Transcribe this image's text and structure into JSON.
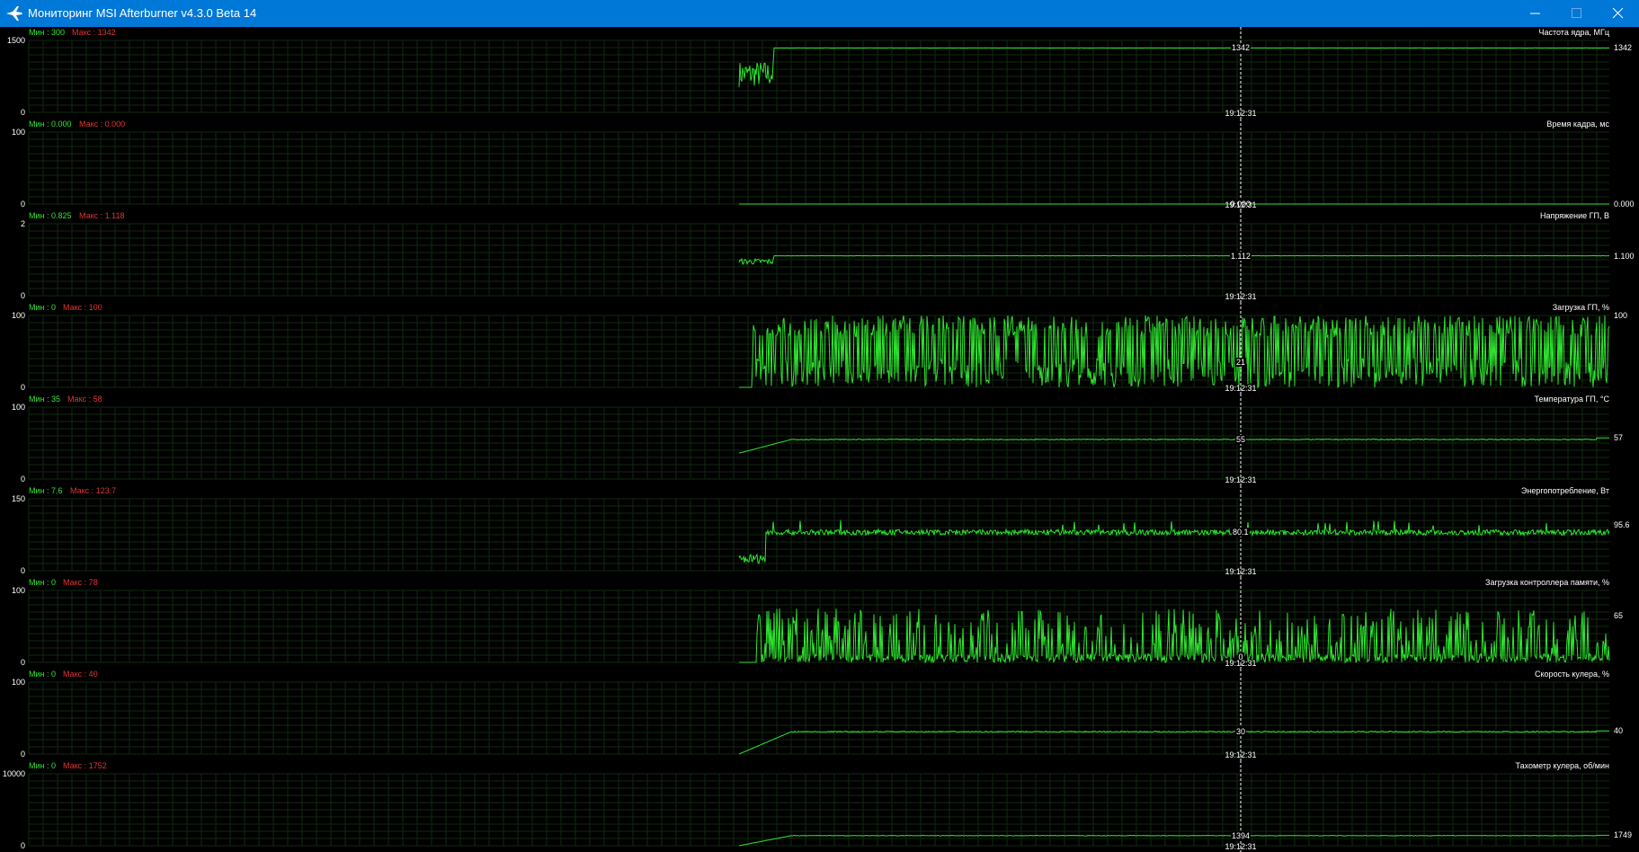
{
  "window": {
    "title": "Мониторинг MSI Afterburner v4.3.0 Beta 14",
    "app_icon": "afterburner-plane-icon",
    "controls": [
      "minimize-icon",
      "maximize-icon",
      "close-icon"
    ]
  },
  "colors": {
    "titlebar": "#0078d7",
    "graph": "#2ee62e",
    "grid": "#0f2a0f",
    "min_label": "#34e834",
    "max_label": "#e23535",
    "cursor": "#ffffff"
  },
  "cursor_time": "19:12:31",
  "graphs": [
    {
      "name": "Частота ядра, МГц",
      "min_label": "Мин : 300",
      "max_label": "Макс : 1342",
      "y_top": "1500",
      "y_bottom": "0",
      "ymax": 1500,
      "cursor_value": "1342",
      "current_value": "1342",
      "pattern": "step",
      "base": 1342,
      "start": 800,
      "noise": 4
    },
    {
      "name": "Время кадра, мс",
      "min_label": "Мин : 0.000",
      "max_label": "Макс : 0.000",
      "y_top": "100",
      "y_bottom": "0",
      "ymax": 100,
      "cursor_value": "0.000",
      "current_value": "0.000",
      "pattern": "flat",
      "base": 0,
      "start": 0,
      "noise": 0
    },
    {
      "name": "Напряжение ГП, В",
      "min_label": "Мин : 0.825",
      "max_label": "Макс : 1.118",
      "y_top": "2",
      "y_bottom": "0",
      "ymax": 2,
      "cursor_value": "1.112",
      "current_value": "1.100",
      "pattern": "step",
      "base": 1.11,
      "start": 0.95,
      "noise": 0.005
    },
    {
      "name": "Загрузка ГП, %",
      "min_label": "Мин : 0",
      "max_label": "Макс : 100",
      "y_top": "100",
      "y_bottom": "0",
      "ymax": 100,
      "cursor_value": "21",
      "current_value": "100",
      "pattern": "spiky",
      "base": 55,
      "start": 0,
      "noise": 45
    },
    {
      "name": "Температура ГП, °С",
      "min_label": "Мин : 35",
      "max_label": "Макс : 58",
      "y_top": "100",
      "y_bottom": "0",
      "ymax": 100,
      "cursor_value": "55",
      "current_value": "57",
      "pattern": "ramp",
      "base": 55,
      "start": 36,
      "noise": 0.6
    },
    {
      "name": "Энергопотребление, Вт",
      "min_label": "Мин : 7.6",
      "max_label": "Макс : 123.7",
      "y_top": "150",
      "y_bottom": "0",
      "ymax": 150,
      "cursor_value": "80.1",
      "current_value": "95.6",
      "pattern": "noisy",
      "base": 80,
      "start": 15,
      "noise": 6
    },
    {
      "name": "Загрузка контроллера памяти, %",
      "min_label": "Мин : 0",
      "max_label": "Макс : 78",
      "y_top": "100",
      "y_bottom": "0",
      "ymax": 100,
      "cursor_value": "0",
      "current_value": "65",
      "pattern": "bursts",
      "base": 25,
      "start": 0,
      "noise": 30
    },
    {
      "name": "Скорость кулера, %",
      "min_label": "Мин : 0",
      "max_label": "Макс : 40",
      "y_top": "100",
      "y_bottom": "0",
      "ymax": 100,
      "cursor_value": "30",
      "current_value": "40",
      "pattern": "ramp",
      "base": 31,
      "start": 0,
      "noise": 0.8
    },
    {
      "name": "Тахометр кулера, об/мин",
      "min_label": "Мин : 0",
      "max_label": "Макс : 1752",
      "y_top": "10000",
      "y_bottom": "0",
      "ymax": 10000,
      "cursor_value": "1394",
      "current_value": "1749",
      "pattern": "ramp",
      "base": 1400,
      "start": 0,
      "noise": 40
    }
  ]
}
